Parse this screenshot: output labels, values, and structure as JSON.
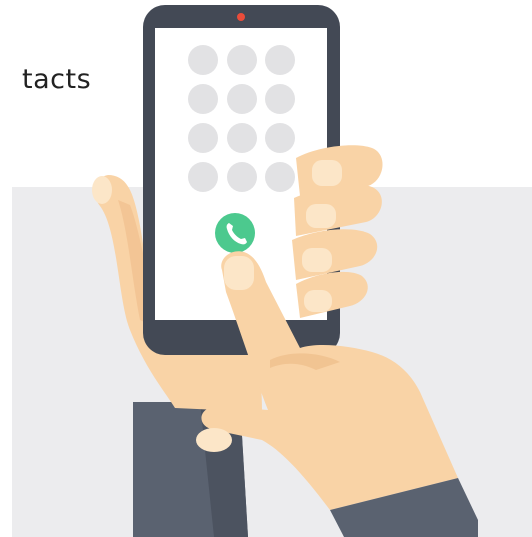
{
  "caption": {
    "text": "tacts"
  },
  "phone": {
    "camera_color": "#ea4c3a",
    "frame_color": "#434955",
    "screen_color": "#ffffff",
    "keypad_dot_color": "#e2e2e4",
    "keypad_rows": 4,
    "keypad_cols": 3
  },
  "call_button": {
    "icon": "phone-handset-icon",
    "color": "#4cc98e"
  },
  "colors": {
    "background_panel": "#ececee",
    "skin": "#f9d3a6",
    "skin_shadow": "#eebd8a",
    "nail": "#fce6c8",
    "sleeve": "#5a6270",
    "sleeve_dark": "#474e5a"
  }
}
